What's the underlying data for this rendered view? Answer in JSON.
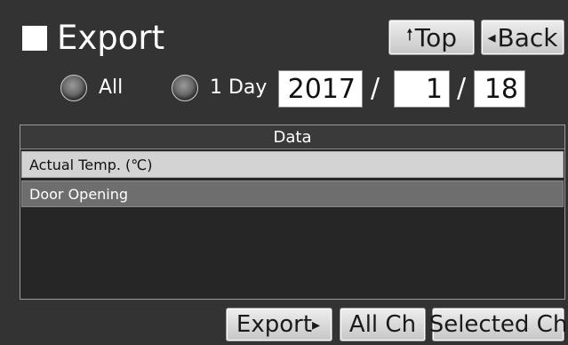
{
  "header": {
    "title": "Export",
    "top_label": "Top",
    "top_glyph": "🠕",
    "back_label": "Back",
    "back_glyph": "◂"
  },
  "range": {
    "all_label": "All",
    "one_day_label": "1 Day"
  },
  "date": {
    "year": "2017",
    "month": "1",
    "day": "18",
    "separator": "/"
  },
  "table": {
    "header": "Data",
    "rows": [
      {
        "label": "Actual Temp. (℃)"
      },
      {
        "label": "Door Opening"
      }
    ]
  },
  "footer": {
    "export_label": "Export",
    "export_glyph": "▸",
    "all_ch_label": "All Ch",
    "selected_ch_label": "Selected Ch"
  },
  "colors": {
    "background": "#333333",
    "button_face": "#dddddd",
    "selected_row": "#d3d3d3",
    "second_row": "#6e6e6e"
  }
}
